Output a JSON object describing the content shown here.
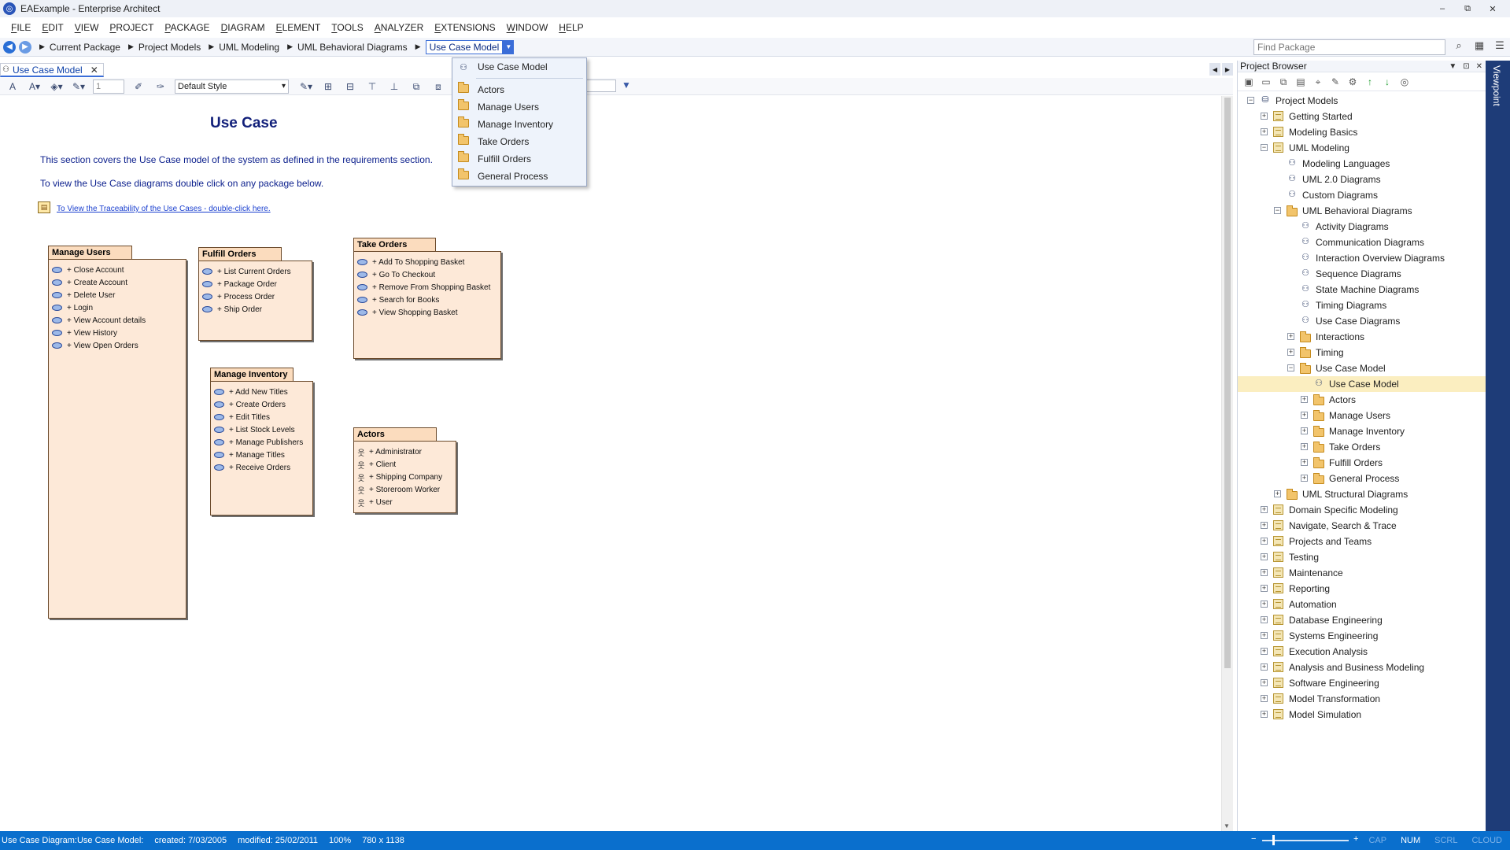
{
  "window": {
    "title": "EAExample - Enterprise Architect",
    "minimize": "–",
    "restore": "⧉",
    "close": "✕"
  },
  "menu": [
    "FILE",
    "EDIT",
    "VIEW",
    "PROJECT",
    "PACKAGE",
    "DIAGRAM",
    "ELEMENT",
    "TOOLS",
    "ANALYZER",
    "EXTENSIONS",
    "WINDOW",
    "HELP"
  ],
  "breadcrumb": {
    "items": [
      "Current Package",
      "Project Models",
      "UML Modeling",
      "UML Behavioral Diagrams"
    ],
    "current": "Use Case Model"
  },
  "find_package": {
    "placeholder": "Find Package"
  },
  "diagram_tab": {
    "label": "Use Case Model"
  },
  "diagram_toolbar": {
    "spin_value": "1",
    "style": "Default Style"
  },
  "dropdown": {
    "top_item": "Use Case Model",
    "items": [
      "Actors",
      "Manage Users",
      "Manage Inventory",
      "Take Orders",
      "Fulfill Orders",
      "General Process"
    ]
  },
  "diagram": {
    "title": "Use Case",
    "note1": "This section covers the Use Case model of the system as defined in the requirements section.",
    "note2": "To view the Use Case diagrams double click on any package below.",
    "trace_link": "To View the Traceability of the Use Cases - double-click here.",
    "packages": {
      "manage_users": {
        "name": "Manage Users",
        "items": [
          "+ Close Account",
          "+ Create Account",
          "+ Delete User",
          "+ Login",
          "+ View Account details",
          "+ View History",
          "+ View Open Orders"
        ]
      },
      "fulfill_orders": {
        "name": "Fulfill Orders",
        "items": [
          "+ List Current Orders",
          "+ Package Order",
          "+ Process Order",
          "+ Ship Order"
        ]
      },
      "take_orders": {
        "name": "Take Orders",
        "items": [
          "+ Add To Shopping Basket",
          "+ Go To Checkout",
          "+ Remove From Shopping Basket",
          "+ Search for Books",
          "+ View Shopping Basket"
        ]
      },
      "manage_inventory": {
        "name": "Manage Inventory",
        "items": [
          "+ Add New Titles",
          "+ Create Orders",
          "+ Edit Titles",
          "+ List Stock Levels",
          "+ Manage Publishers",
          "+ Manage Titles",
          "+ Receive Orders"
        ]
      },
      "actors": {
        "name": "Actors",
        "items": [
          "+ Administrator",
          "+ Client",
          "+ Shipping Company",
          "+ Storeroom Worker",
          "+ User"
        ]
      }
    }
  },
  "project_browser": {
    "title": "Project Browser",
    "tree": [
      {
        "label": "Project Models",
        "depth": 0,
        "expander": "−",
        "icon": "stack"
      },
      {
        "label": "Getting Started",
        "depth": 1,
        "expander": "+",
        "icon": "model-book"
      },
      {
        "label": "Modeling Basics",
        "depth": 1,
        "expander": "+",
        "icon": "model-book"
      },
      {
        "label": "UML Modeling",
        "depth": 1,
        "expander": "−",
        "icon": "model-book"
      },
      {
        "label": "Modeling Languages",
        "depth": 2,
        "expander": "",
        "icon": "diagram"
      },
      {
        "label": "UML 2.0 Diagrams",
        "depth": 2,
        "expander": "",
        "icon": "diagram"
      },
      {
        "label": "Custom Diagrams",
        "depth": 2,
        "expander": "",
        "icon": "diagram"
      },
      {
        "label": "UML Behavioral Diagrams",
        "depth": 2,
        "expander": "−",
        "icon": "folder"
      },
      {
        "label": "Activity Diagrams",
        "depth": 3,
        "expander": "",
        "icon": "diagram"
      },
      {
        "label": "Communication Diagrams",
        "depth": 3,
        "expander": "",
        "icon": "diagram"
      },
      {
        "label": "Interaction Overview Diagrams",
        "depth": 3,
        "expander": "",
        "icon": "diagram"
      },
      {
        "label": "Sequence Diagrams",
        "depth": 3,
        "expander": "",
        "icon": "diagram"
      },
      {
        "label": "State Machine Diagrams",
        "depth": 3,
        "expander": "",
        "icon": "diagram"
      },
      {
        "label": "Timing Diagrams",
        "depth": 3,
        "expander": "",
        "icon": "diagram"
      },
      {
        "label": "Use Case Diagrams",
        "depth": 3,
        "expander": "",
        "icon": "diagram"
      },
      {
        "label": "Interactions",
        "depth": 3,
        "expander": "+",
        "icon": "folder"
      },
      {
        "label": "Timing",
        "depth": 3,
        "expander": "+",
        "icon": "folder"
      },
      {
        "label": "Use Case Model",
        "depth": 3,
        "expander": "−",
        "icon": "folder"
      },
      {
        "label": "Use Case Model",
        "depth": 4,
        "expander": "",
        "icon": "diagram",
        "selected": true
      },
      {
        "label": "Actors",
        "depth": 4,
        "expander": "+",
        "icon": "folder"
      },
      {
        "label": "Manage Users",
        "depth": 4,
        "expander": "+",
        "icon": "folder"
      },
      {
        "label": "Manage Inventory",
        "depth": 4,
        "expander": "+",
        "icon": "folder"
      },
      {
        "label": "Take Orders",
        "depth": 4,
        "expander": "+",
        "icon": "folder"
      },
      {
        "label": "Fulfill Orders",
        "depth": 4,
        "expander": "+",
        "icon": "folder"
      },
      {
        "label": "General Process",
        "depth": 4,
        "expander": "+",
        "icon": "folder"
      },
      {
        "label": "UML Structural Diagrams",
        "depth": 2,
        "expander": "+",
        "icon": "folder"
      },
      {
        "label": "Domain Specific Modeling",
        "depth": 1,
        "expander": "+",
        "icon": "model-book"
      },
      {
        "label": "Navigate, Search & Trace",
        "depth": 1,
        "expander": "+",
        "icon": "model-book"
      },
      {
        "label": "Projects and Teams",
        "depth": 1,
        "expander": "+",
        "icon": "model-book"
      },
      {
        "label": "Testing",
        "depth": 1,
        "expander": "+",
        "icon": "model-book"
      },
      {
        "label": "Maintenance",
        "depth": 1,
        "expander": "+",
        "icon": "model-book"
      },
      {
        "label": "Reporting",
        "depth": 1,
        "expander": "+",
        "icon": "model-book"
      },
      {
        "label": "Automation",
        "depth": 1,
        "expander": "+",
        "icon": "model-book"
      },
      {
        "label": "Database Engineering",
        "depth": 1,
        "expander": "+",
        "icon": "model-book"
      },
      {
        "label": "Systems Engineering",
        "depth": 1,
        "expander": "+",
        "icon": "model-book"
      },
      {
        "label": "Execution Analysis",
        "depth": 1,
        "expander": "+",
        "icon": "model-book"
      },
      {
        "label": "Analysis and Business Modeling",
        "depth": 1,
        "expander": "+",
        "icon": "model-book"
      },
      {
        "label": "Software Engineering",
        "depth": 1,
        "expander": "+",
        "icon": "model-book"
      },
      {
        "label": "Model Transformation",
        "depth": 1,
        "expander": "+",
        "icon": "model-book"
      },
      {
        "label": "Model Simulation",
        "depth": 1,
        "expander": "+",
        "icon": "model-book"
      }
    ]
  },
  "viewpoint": {
    "label": "Viewpoint"
  },
  "statusbar": {
    "diagram_info": "Use Case Diagram:Use Case Model:",
    "created": "created: 7/03/2005",
    "modified": "modified: 25/02/2011",
    "zoom": "100%",
    "size": "780 x 1138",
    "zoom_minus": "−",
    "zoom_plus": "+",
    "cap": "CAP",
    "num": "NUM",
    "scrl": "SCRL",
    "cloud": "CLOUD"
  }
}
